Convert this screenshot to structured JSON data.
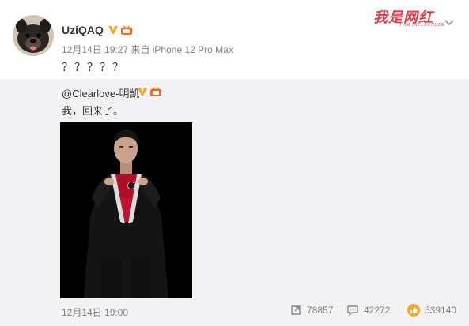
{
  "post": {
    "author": "UziQAQ",
    "time": "12月14日 19:27",
    "source_prefix": "来自",
    "source": "iPhone 12 Pro Max",
    "text": "？？？？？"
  },
  "watermark": {
    "title": "我是网红",
    "subtitle": "I AM INFLUENCER"
  },
  "repost": {
    "author": "@Clearlove-明凯",
    "text": "我，回来了。",
    "time": "12月14日 19:00",
    "stats": {
      "reposts": "78857",
      "comments": "42272",
      "likes": "539140"
    }
  },
  "colors": {
    "verify_badge": "#f5a623",
    "accent_red": "#e23b4b",
    "repost_bg": "#f2f2f5",
    "like_icon": "#f5a623"
  },
  "icons": {
    "repost": "repost-icon",
    "comment": "comment-icon",
    "like": "like-icon",
    "expand": "chevron-down-icon"
  }
}
